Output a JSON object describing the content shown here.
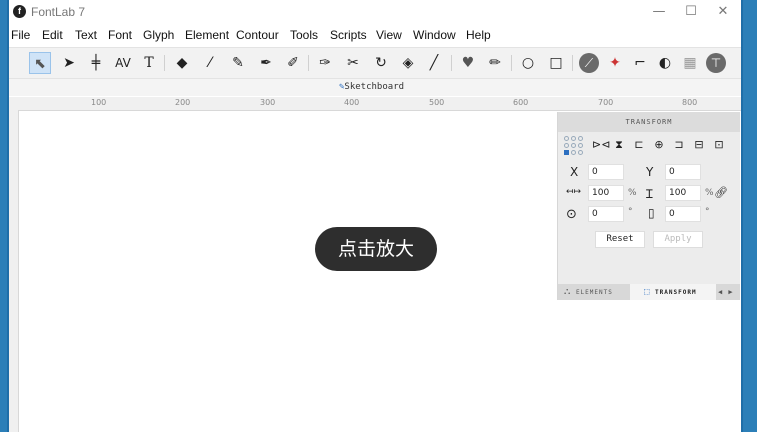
{
  "window": {
    "title": "FontLab 7",
    "logo": "f",
    "controls": {
      "minimize": "—",
      "maximize": "☐",
      "close": "✕"
    }
  },
  "menu": [
    "File",
    "Edit",
    "Text",
    "Font",
    "Glyph",
    "Element",
    "Contour",
    "Tools",
    "Scripts",
    "View",
    "Window",
    "Help"
  ],
  "toolbar": {
    "tools": [
      {
        "name": "select-tool-icon",
        "glyph": "⬉",
        "selected": true
      },
      {
        "name": "contour-select-icon",
        "glyph": "➤"
      },
      {
        "name": "metrics-tool-icon",
        "glyph": "╪"
      },
      {
        "name": "kerning-tool-icon",
        "glyph": "AV"
      },
      {
        "name": "text-tool-icon",
        "glyph": "T"
      },
      {
        "name": "eraser-tool-icon",
        "glyph": "◆"
      },
      {
        "name": "brush-tool-icon",
        "glyph": "⁄"
      },
      {
        "name": "pencil-tool-icon",
        "glyph": "✎"
      },
      {
        "name": "pen-tool-icon",
        "glyph": "✒"
      },
      {
        "name": "rapid-tool-icon",
        "glyph": "✐"
      },
      {
        "name": "knife-tool-icon",
        "glyph": "✑"
      },
      {
        "name": "scissors-tool-icon",
        "glyph": "✂"
      },
      {
        "name": "rotate-tool-icon",
        "glyph": "↻"
      },
      {
        "name": "fill-tool-icon",
        "glyph": "◈"
      },
      {
        "name": "calligraphy-tool-icon",
        "glyph": "╱"
      },
      {
        "name": "heart-shape-icon",
        "glyph": "♥"
      },
      {
        "name": "eyedropper-icon",
        "glyph": "✏"
      },
      {
        "name": "ellipse-tool-icon",
        "glyph": "○"
      },
      {
        "name": "rectangle-tool-icon",
        "glyph": "□"
      },
      {
        "name": "hand-tool-icon",
        "glyph": "⟋"
      },
      {
        "name": "magnet-tool-icon",
        "glyph": "✦"
      },
      {
        "name": "corner-tool-icon",
        "glyph": "⌐"
      },
      {
        "name": "contrast-tool-icon",
        "glyph": "◐"
      },
      {
        "name": "grid-tool-icon",
        "glyph": "▦"
      },
      {
        "name": "measure-tool-icon",
        "glyph": "⊤"
      }
    ]
  },
  "document_tab": "Sketchboard",
  "ruler": {
    "ticks": [
      "100",
      "200",
      "300",
      "400",
      "500",
      "600",
      "700",
      "800"
    ]
  },
  "canvas": {
    "zoom_hint": "点击放大"
  },
  "transform_panel": {
    "title": "TRANSFORM",
    "x_label": "X",
    "x_value": "0",
    "y_label": "Y",
    "y_value": "0",
    "width_value": "100",
    "width_unit": "%",
    "height_value": "100",
    "height_unit": "%",
    "rotate_value": "0",
    "rotate_unit": "°",
    "slant_value": "0",
    "slant_unit": "°",
    "reset_label": "Reset",
    "apply_label": "Apply"
  },
  "panel_tabs": {
    "elements": "ELEMENTS",
    "transform": "TRANSFORM",
    "arrows": "◀ ▶"
  },
  "colors": {
    "frame": "#2c7fb8",
    "selection": "#cfe3f7",
    "pill": "#2e2e2e"
  }
}
